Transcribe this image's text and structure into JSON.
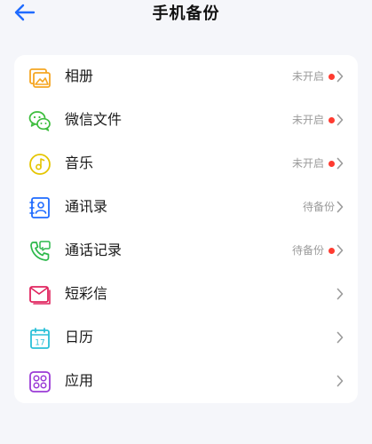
{
  "header": {
    "title": "手机备份",
    "back_icon": "arrow-left-icon"
  },
  "colors": {
    "accent": "#1f6bff",
    "status_dot": "#ff3b30",
    "album_icon": "#f5a623",
    "wechat_icon": "#3dbd3d",
    "music_icon": "#e5c500",
    "contacts_icon": "#1f6bff",
    "calls_icon": "#2cb84b",
    "sms_icon": "#e0245e",
    "calendar_icon": "#2ac0d8",
    "apps_icon": "#9b3bd6"
  },
  "items": [
    {
      "label": "相册",
      "status": "未开启",
      "dot": true,
      "icon": "photo-album-icon"
    },
    {
      "label": "微信文件",
      "status": "未开启",
      "dot": true,
      "icon": "wechat-icon"
    },
    {
      "label": "音乐",
      "status": "未开启",
      "dot": true,
      "icon": "music-icon"
    },
    {
      "label": "通讯录",
      "status": "待备份",
      "dot": false,
      "icon": "contacts-icon"
    },
    {
      "label": "通话记录",
      "status": "待备份",
      "dot": true,
      "icon": "call-log-icon"
    },
    {
      "label": "短彩信",
      "status": "",
      "dot": false,
      "icon": "sms-icon"
    },
    {
      "label": "日历",
      "status": "",
      "dot": false,
      "icon": "calendar-icon"
    },
    {
      "label": "应用",
      "status": "",
      "dot": false,
      "icon": "apps-icon"
    }
  ],
  "calendar_day": "17"
}
